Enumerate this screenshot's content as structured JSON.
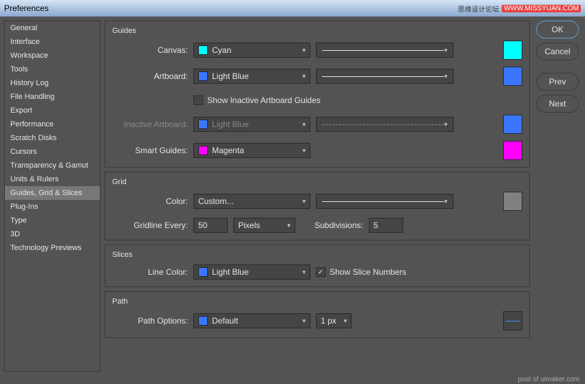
{
  "window": {
    "title": "Preferences"
  },
  "watermark": {
    "cn": "思缘设计论坛",
    "url": "WWW.MISSYUAN.COM"
  },
  "sidebar": {
    "items": [
      {
        "label": "General"
      },
      {
        "label": "Interface"
      },
      {
        "label": "Workspace"
      },
      {
        "label": "Tools"
      },
      {
        "label": "History Log"
      },
      {
        "label": "File Handling"
      },
      {
        "label": "Export"
      },
      {
        "label": "Performance"
      },
      {
        "label": "Scratch Disks"
      },
      {
        "label": "Cursors"
      },
      {
        "label": "Transparency & Gamut"
      },
      {
        "label": "Units & Rulers"
      },
      {
        "label": "Guides, Grid & Slices",
        "active": true
      },
      {
        "label": "Plug-Ins"
      },
      {
        "label": "Type"
      },
      {
        "label": "3D"
      },
      {
        "label": "Technology Previews"
      }
    ]
  },
  "buttons": {
    "ok": "OK",
    "cancel": "Cancel",
    "prev": "Prev",
    "next": "Next"
  },
  "guides": {
    "title": "Guides",
    "canvas_label": "Canvas:",
    "canvas_value": "Cyan",
    "canvas_color": "#00ffff",
    "artboard_label": "Artboard:",
    "artboard_value": "Light Blue",
    "artboard_color": "#3a76ff",
    "show_inactive_label": "Show Inactive Artboard Guides",
    "show_inactive_checked": false,
    "inactive_label": "Inactive Artboard:",
    "inactive_value": "Light Blue",
    "inactive_color": "#3a76ff",
    "smart_label": "Smart Guides:",
    "smart_value": "Magenta",
    "smart_color": "#ff00ff"
  },
  "grid": {
    "title": "Grid",
    "color_label": "Color:",
    "color_value": "Custom...",
    "color_swatch": "#808080",
    "every_label": "Gridline Every:",
    "every_value": "50",
    "every_unit": "Pixels",
    "sub_label": "Subdivisions:",
    "sub_value": "5"
  },
  "slices": {
    "title": "Slices",
    "color_label": "Line Color:",
    "color_value": "Light Blue",
    "color_swatch": "#3a76ff",
    "show_numbers_label": "Show Slice Numbers",
    "show_numbers_checked": true
  },
  "path": {
    "title": "Path",
    "options_label": "Path Options:",
    "options_value": "Default",
    "options_swatch": "#3a76ff",
    "width_value": "1 px"
  },
  "footer": "post of uimaker.com"
}
